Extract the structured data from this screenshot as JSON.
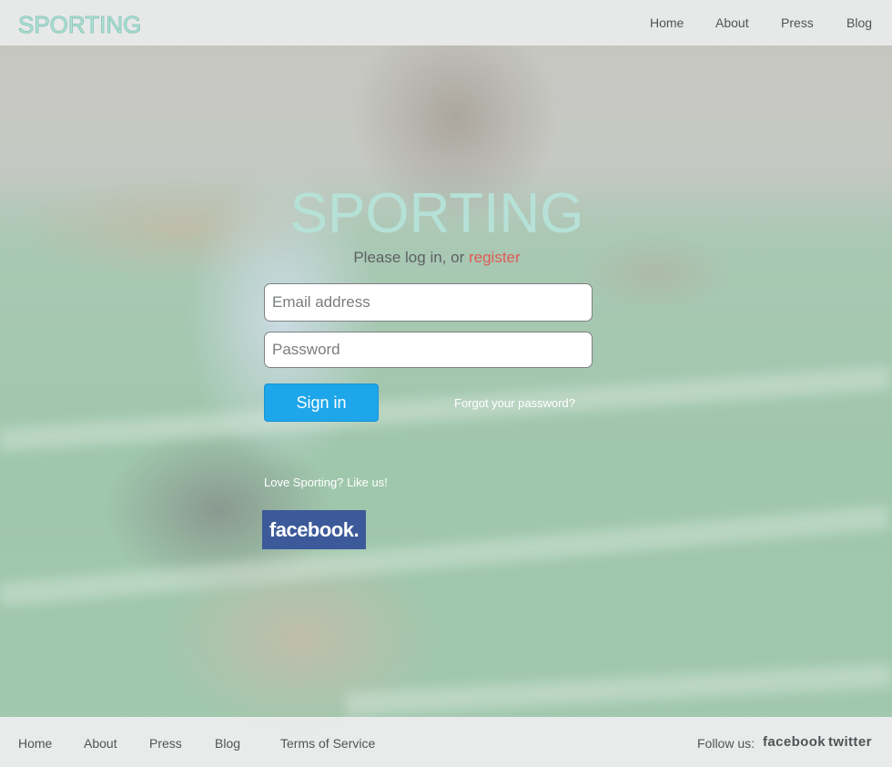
{
  "brand": "SPORTING",
  "top_nav": {
    "items": [
      {
        "label": "Home"
      },
      {
        "label": "About"
      },
      {
        "label": "Press"
      },
      {
        "label": "Blog"
      }
    ]
  },
  "login": {
    "title": "SPORTING",
    "subtitle_prefix": "Please log in, or ",
    "register_label": "register",
    "email_placeholder": "Email address",
    "email_value": "",
    "password_placeholder": "Password",
    "password_value": "",
    "signin_label": "Sign in",
    "forgot_label": "Forgot your password?",
    "like_text": "Love Sporting? Like us!",
    "facebook_label": "facebook."
  },
  "footer": {
    "links": [
      {
        "label": "Home"
      },
      {
        "label": "About"
      },
      {
        "label": "Press"
      },
      {
        "label": "Blog"
      },
      {
        "label": "Terms of Service"
      }
    ],
    "follow_label": "Follow us:",
    "social": [
      {
        "label": "facebook"
      },
      {
        "label": "twitter"
      }
    ]
  },
  "colors": {
    "accent_mint": "#b3e3d7",
    "button_blue": "#1da6ea",
    "register_red": "#e05a55",
    "facebook_blue": "#3c5a99"
  },
  "icons": {
    "background": "sprinter-photo"
  }
}
